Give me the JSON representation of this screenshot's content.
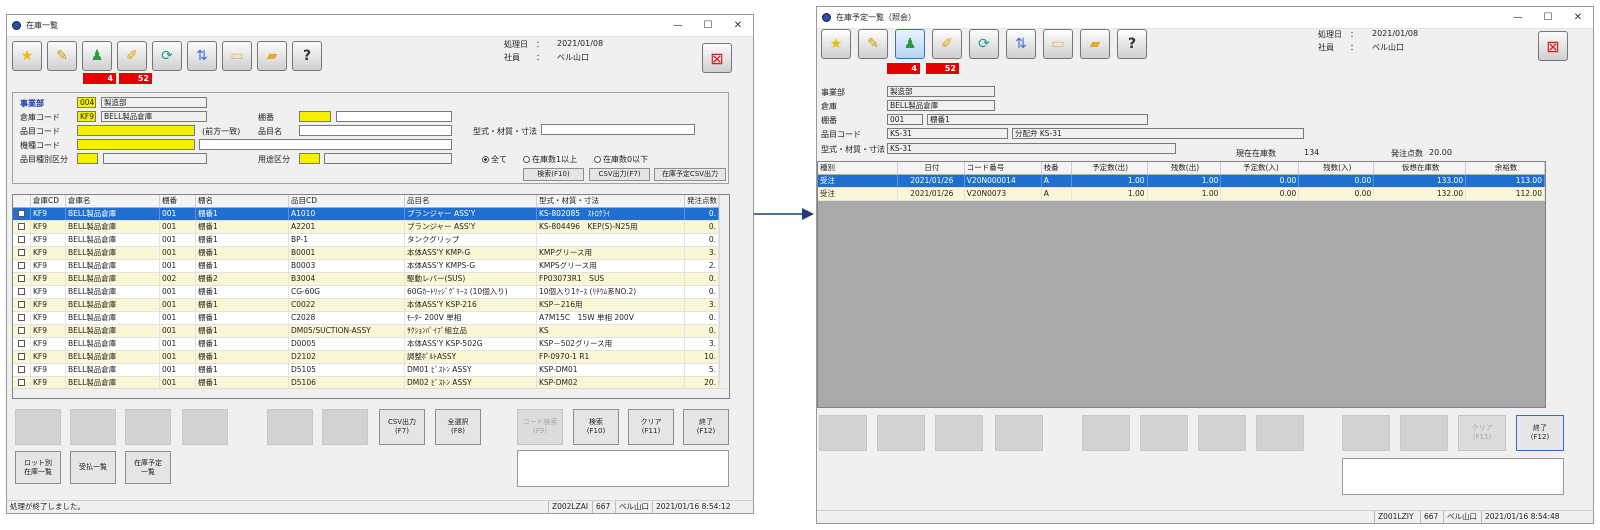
{
  "left": {
    "title": "在庫一覧",
    "controls": {
      "min": "—",
      "max": "☐",
      "close": "✕"
    },
    "badges": [
      "4",
      "52"
    ],
    "header": {
      "date_label": "処理日　：",
      "date": "2021/01/08",
      "user_label": "社員　　：",
      "user": "ベル山口"
    },
    "filters": {
      "division_label": "事業部",
      "division_code": "004",
      "division_name": "製造部",
      "warehouse_label": "倉庫コード",
      "warehouse_code": "KF9",
      "warehouse_name": "BELL製品倉庫",
      "shelf_label": "棚番",
      "item_code_label": "品目コード",
      "prefix_match": "(前方一致)",
      "item_name_label": "品目名",
      "model_label": "型式・材質・寸法",
      "type_code_label": "機種コード",
      "category_label": "品目種別区分",
      "usage_label": "用途区分",
      "radios": [
        "全て",
        "在庫数1以上",
        "在庫数0以下"
      ],
      "search_btn": "検索(F10)",
      "csv_btn": "CSV出力(F7)",
      "plan_csv_btn": "在庫予定CSV出力"
    },
    "columns": [
      "倉庫CD",
      "倉庫名",
      "棚番",
      "棚名",
      "品目CD",
      "品目名",
      "型式・材質・寸法",
      "発注点数"
    ],
    "rows": [
      [
        "KF9",
        "BELL製品倉庫",
        "001",
        "棚番1",
        "A1010",
        "プランジャー ASS'Y",
        "KS-802085　ｽﾄﾛｸﾗｲ",
        "0."
      ],
      [
        "KF9",
        "BELL製品倉庫",
        "001",
        "棚番1",
        "A2201",
        "プランジャー ASS'Y",
        "KS-804496　KEP(S)-N25用",
        "0."
      ],
      [
        "KF9",
        "BELL製品倉庫",
        "001",
        "棚番1",
        "BP-1",
        "タンクグリップ",
        "",
        "0."
      ],
      [
        "KF9",
        "BELL製品倉庫",
        "001",
        "棚番1",
        "B0001",
        "本体ASS'Y KMP-G",
        "KMPグリース用",
        "3."
      ],
      [
        "KF9",
        "BELL製品倉庫",
        "001",
        "棚番1",
        "B0003",
        "本体ASS'Y KMPS-G",
        "KMPSグリース用",
        "2."
      ],
      [
        "KF9",
        "BELL製品倉庫",
        "002",
        "棚番2",
        "B3004",
        "駆動レバー(SUS)",
        "FP03073R1　SUS",
        "0."
      ],
      [
        "KF9",
        "BELL製品倉庫",
        "001",
        "棚番1",
        "CG-60G",
        "60Gｶｰﾄﾘｯｼﾞｸﾞﾘｰｽ (10個入り)",
        "10個入り1ｹｰｽ (ﾘﾁｳﾑ系NO.2)",
        "0."
      ],
      [
        "KF9",
        "BELL製品倉庫",
        "001",
        "棚番1",
        "C0022",
        "本体ASS'Y KSP-216",
        "KSP－216用",
        "3."
      ],
      [
        "KF9",
        "BELL製品倉庫",
        "001",
        "棚番1",
        "C2028",
        "ﾓｰﾀｰ 200V 単相",
        "A7M15C　15W 単相 200V",
        "0."
      ],
      [
        "KF9",
        "BELL製品倉庫",
        "001",
        "棚番1",
        "DM05/SUCTION-ASSY",
        "ｻｸｼｮﾝﾊﾟｲﾌﾟ組立品",
        "KS",
        "0."
      ],
      [
        "KF9",
        "BELL製品倉庫",
        "001",
        "棚番1",
        "D0005",
        "本体ASS'Y KSP-502G",
        "KSP－502グリース用",
        "3."
      ],
      [
        "KF9",
        "BELL製品倉庫",
        "001",
        "棚番1",
        "D2102",
        "調整ﾎﾞﾙﾄASSY",
        "FP-0970-1 R1",
        "10."
      ],
      [
        "KF9",
        "BELL製品倉庫",
        "001",
        "棚番1",
        "D5105",
        "DM01 ﾋﾟｽﾄﾝ ASSY",
        "KSP-DM01",
        "5."
      ],
      [
        "KF9",
        "BELL製品倉庫",
        "001",
        "棚番1",
        "D5106",
        "DM02 ﾋﾟｽﾄﾝ ASSY",
        "KSP-DM02",
        "20."
      ]
    ],
    "buttons": {
      "csv": "CSV出力\n(F7)",
      "select_all": "全選択\n(F8)",
      "code_search": "コード検索\n(F9)",
      "search": "検索\n(F10)",
      "clear": "クリア\n(F11)",
      "exit": "終了\n(F12)",
      "lot": "ロット別\n在庫一覧",
      "receipt": "受払一覧",
      "plan": "在庫予定\n一覧"
    },
    "status": {
      "message": "処理が終了しました。",
      "screen": "Z002LZAI",
      "code": "667",
      "user": "ベル山口",
      "datetime": "2021/01/16 8:54:12"
    }
  },
  "right": {
    "title": "在庫予定一覧（照会）",
    "controls": {
      "min": "—",
      "max": "☐",
      "close": "✕"
    },
    "badges": [
      "4",
      "52"
    ],
    "header": {
      "date_label": "処理日　：",
      "date": "2021/01/08",
      "user_label": "社員　　：",
      "user": "ベル山口"
    },
    "info": {
      "division_label": "事業部",
      "division": "製造部",
      "warehouse_label": "倉庫",
      "warehouse": "BELL製品倉庫",
      "shelf_label": "棚番",
      "shelf_code": "001",
      "shelf_name": "棚番1",
      "item_label": "品目コード",
      "item_code": "KS-31",
      "item_name": "分配弁 KS-31",
      "model_label": "型式・材質・寸法",
      "model": "KS-31",
      "stock_label": "現在在庫数",
      "stock": "134",
      "order_label": "発注点数",
      "order": "20.00"
    },
    "columns": [
      "種別",
      "日付",
      "コード番号",
      "枝番",
      "予定数(出)",
      "残数(出)",
      "予定数(入)",
      "残数(入)",
      "仮想在庫数",
      "余裕数"
    ],
    "rows": [
      [
        "受注",
        "2021/01/26",
        "V20N000014",
        "A",
        "1.00",
        "1.00",
        "0.00",
        "0.00",
        "133.00",
        "113.00"
      ],
      [
        "受注",
        "2021/01/26",
        "V20N0073",
        "A",
        "1.00",
        "1.00",
        "0.00",
        "0.00",
        "132.00",
        "112.00"
      ]
    ],
    "buttons": {
      "clear": "クリア\n(F11)",
      "exit": "終了\n(F12)"
    },
    "status": {
      "screen": "Z001LZIY",
      "code": "667",
      "user": "ベル山口",
      "datetime": "2021/01/16 8:54:48"
    }
  }
}
